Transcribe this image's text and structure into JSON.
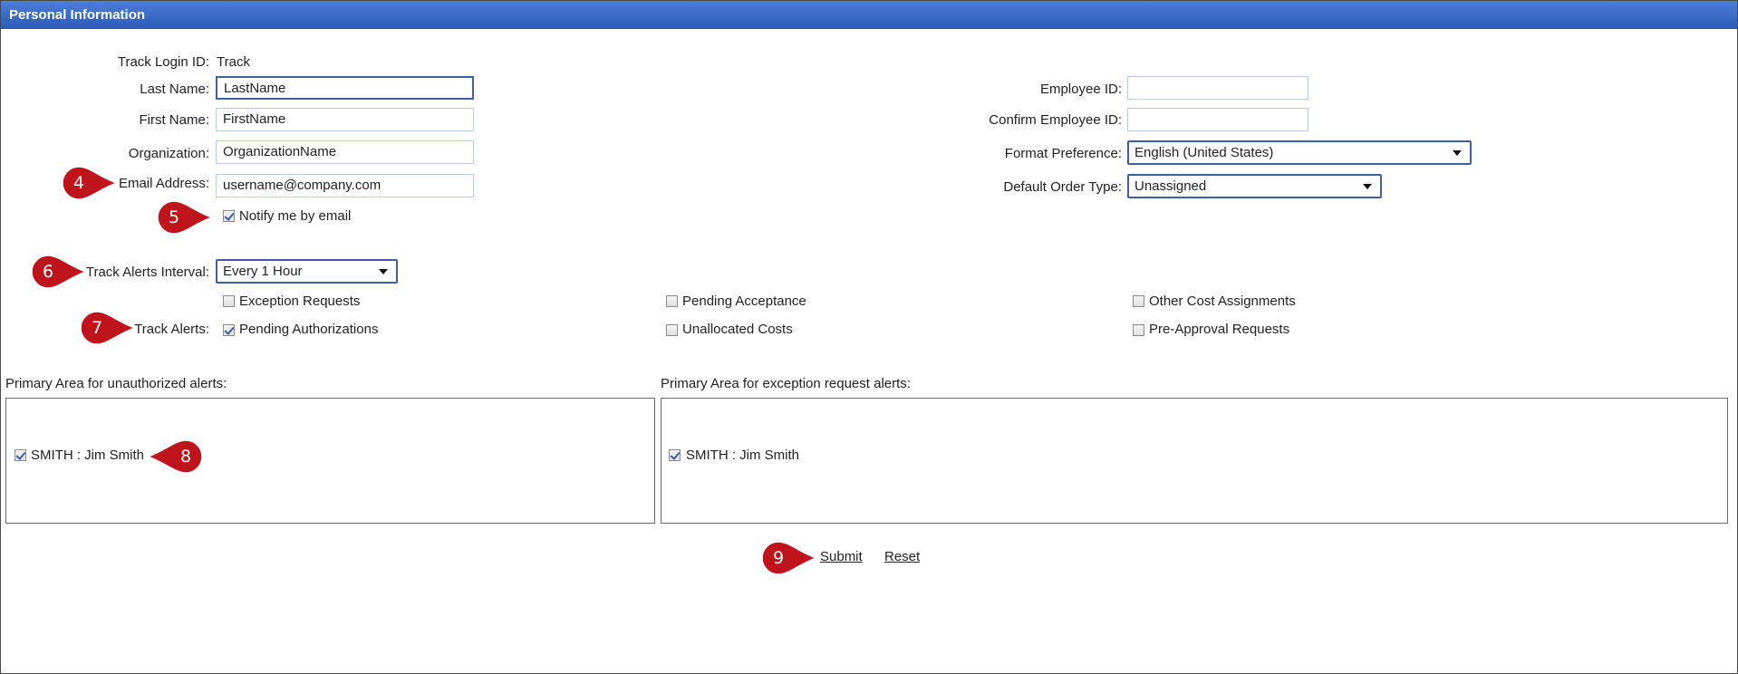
{
  "title": "Personal Information",
  "fields": {
    "track_login_label": "Track Login ID:",
    "track_login_value": "Track",
    "last_name_label": "Last Name:",
    "last_name_value": "LastName",
    "first_name_label": "First Name:",
    "first_name_value": "FirstName",
    "organization_label": "Organization:",
    "organization_value": "OrganizationName",
    "email_label": "Email Address:",
    "email_value": "username@company.com",
    "notify_label": "Notify me by email",
    "employee_id_label": "Employee ID:",
    "employee_id_value": "",
    "confirm_employee_id_label": "Confirm Employee ID:",
    "confirm_employee_id_value": "",
    "format_pref_label": "Format Preference:",
    "format_pref_value": "English (United States)",
    "default_order_label": "Default Order Type:",
    "default_order_value": "Unassigned",
    "alerts_interval_label": "Track Alerts Interval:",
    "alerts_interval_value": "Every 1 Hour",
    "track_alerts_label": "Track Alerts:"
  },
  "alerts": {
    "exception_requests": "Exception Requests",
    "pending_authorizations": "Pending Authorizations",
    "pending_acceptance": "Pending Acceptance",
    "unallocated_costs": "Unallocated Costs",
    "other_cost_assignments": "Other Cost Assignments",
    "pre_approval_requests": "Pre-Approval Requests"
  },
  "areas": {
    "unauthorized_title": "Primary Area for unauthorized alerts:",
    "unauthorized_item": "SMITH : Jim Smith",
    "exception_title": "Primary Area for exception request alerts:",
    "exception_item": "SMITH : Jim Smith"
  },
  "actions": {
    "submit": "Submit",
    "reset": "Reset"
  },
  "callouts": {
    "c4": "4",
    "c5": "5",
    "c6": "6",
    "c7": "7",
    "c8": "8",
    "c9": "9"
  },
  "colors": {
    "titlebar": "#2b5ab8",
    "callout": "#c0141c"
  }
}
